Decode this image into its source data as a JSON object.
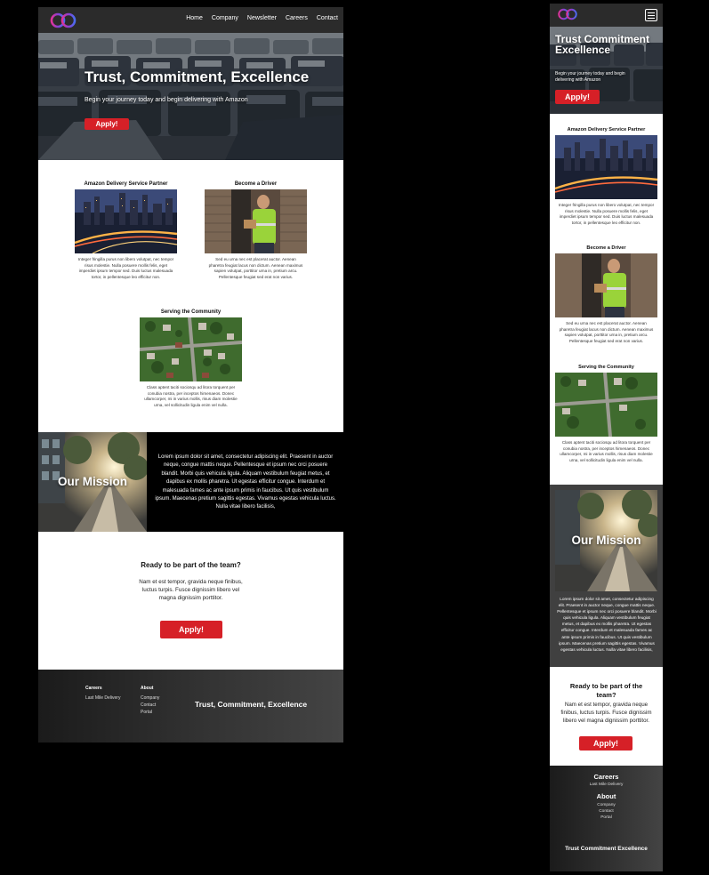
{
  "brand": {
    "logo_colors": [
      "#e0339a",
      "#8a3fd1",
      "#4b6cf0"
    ]
  },
  "nav": {
    "links": [
      "Home",
      "Company",
      "Newsletter",
      "Careers",
      "Contact"
    ],
    "menu_icon": "hamburger-menu-icon"
  },
  "hero": {
    "title": "Trust, Commitment, Excellence",
    "mobile_title": "Trust Commitment Excellence",
    "subtitle": "Begin your journey today and begin delivering with Amazon",
    "apply": "Apply!"
  },
  "cards": [
    {
      "title": "Amazon Delivery Service Partner",
      "image": "city-night-image",
      "text": "Integer fringilla purus non libero volutpat, nec tempor risus molestie. Nulla posuere mollis felis, eget imperdiet ipsum tempor sed. Duis luctus malesuada tortor, in pellentesque leo efficitur non."
    },
    {
      "title": "Become a Driver",
      "image": "driver-delivery-image",
      "text": "Sed eu urna nec est placerat auctor. Aenean pharetra feugiat lacus non dictum. Aenean maximus sapien volutpat, porttitor urna in, pretium arcu. Pellentesque feugiat sed erat non varius."
    },
    {
      "title": "Serving the Community",
      "image": "aerial-neighborhood-image",
      "text": "Class aptent taciti sociosqu ad litora torquent per conubia nostra, per inceptos himenaeos. Donec ullamcorper, mi in varius mollis, risus diam molestie urna, vel sollicitudin ligula enim vel nulla."
    }
  ],
  "mission": {
    "title": "Our Mission",
    "image": "street-sunset-image",
    "text": "Lorem ipsum dolor sit amet, consectetur adipiscing elit. Praesent in auctor neque, congue mattis neque. Pellentesque et ipsum nec orci posuere blandit. Morbi quis vehicula ligula. Aliquam vestibulum feugiat metus, et dapibus ex mollis pharetra. Ut egestas efficitur congue. Interdum et malesuada fames ac ante ipsum primis in faucibus. Ut quis vestibulum ipsum. Maecenas pretium sagittis egestas. Vivamus egestas vehicula luctus. Nulla vitae libero facilisis,"
  },
  "cta": {
    "title": "Ready to be part of the team?",
    "text": "Nam et est tempor, gravida neque finibus, luctus turpis. Fusce dignissim libero vel magna dignissim porttitor.",
    "apply": "Apply!"
  },
  "footer": {
    "careers_heading": "Careers",
    "careers_links": [
      "Last Mile Delivery"
    ],
    "about_heading": "About",
    "about_links": [
      "Company",
      "Contact",
      "Portal"
    ],
    "tagline": "Trust, Commitment, Excellence",
    "mobile_tagline": "Trust Commitment Excellence"
  },
  "colors": {
    "accent": "#d62027",
    "nav": "#2b2b2b",
    "footer": "#333333",
    "mission_mobile": "#404040"
  }
}
